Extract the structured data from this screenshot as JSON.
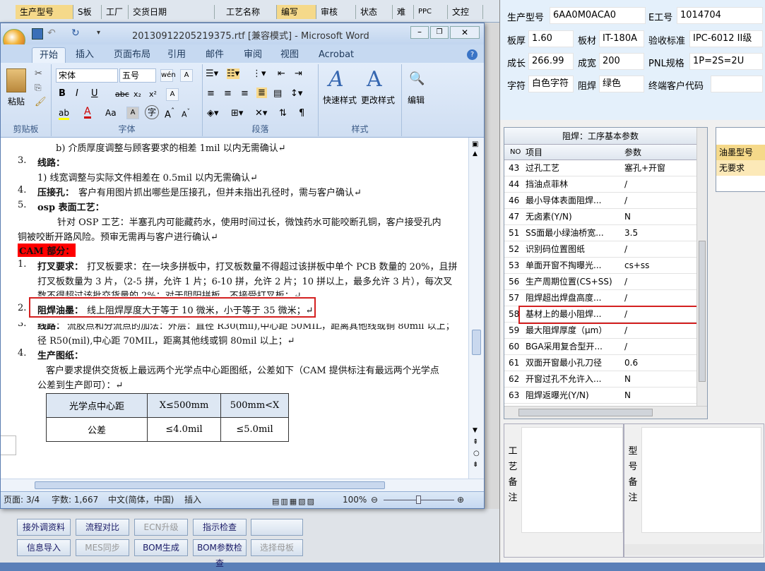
{
  "top_columns": [
    "生产型号",
    "S板",
    "工厂",
    "交货日期",
    "工艺名称",
    "编写",
    "审核",
    "状态",
    "难",
    "PPC",
    "文控"
  ],
  "info": {
    "prod_model_label": "生产型号",
    "prod_model": "6AA0M0ACA0",
    "e_no_label": "E工号",
    "e_no": "1014704",
    "thickness_label": "板厚",
    "thickness": "1.60",
    "material_label": "板材",
    "material": "IT-180A",
    "standard_label": "验收标准",
    "standard": "IPC-6012 II级",
    "length_label": "成长",
    "length": "266.99",
    "width_label": "成宽",
    "width": "200",
    "pnl_label": "PNL规格",
    "pnl": "1P=2S=2U",
    "char_label": "字符",
    "char": "白色字符",
    "mask_label": "阻焊",
    "mask": "绿色",
    "customer_label": "终端客户代码",
    "customer": ""
  },
  "param_grid": {
    "title": "阻焊：工序基本参数",
    "col_no": "NO",
    "col_item": "项目",
    "col_param": "参数",
    "rows": [
      {
        "no": "43",
        "item": "过孔工艺",
        "param": "塞孔+开窗"
      },
      {
        "no": "44",
        "item": "挡油点菲林",
        "param": "/"
      },
      {
        "no": "46",
        "item": "最小导体表面阻焊...",
        "param": "/"
      },
      {
        "no": "47",
        "item": "无卤素(Y/N)",
        "param": "N"
      },
      {
        "no": "51",
        "item": "SS面最小绿油桥宽...",
        "param": "3.5"
      },
      {
        "no": "52",
        "item": "识别码位置图纸",
        "param": "/"
      },
      {
        "no": "53",
        "item": "单面开窗不掏曝光...",
        "param": "cs+ss"
      },
      {
        "no": "56",
        "item": "生产周期位置(CS+SS)",
        "param": "/"
      },
      {
        "no": "57",
        "item": "阻焊超出焊盘高度...",
        "param": "/"
      },
      {
        "no": "58",
        "item": "基材上的最小阻焊...",
        "param": "/"
      },
      {
        "no": "59",
        "item": "最大阻焊厚度（μm）",
        "param": "/"
      },
      {
        "no": "60",
        "item": "BGA采用复合型开...",
        "param": "/"
      },
      {
        "no": "61",
        "item": "双面开窗最小孔刀径",
        "param": "0.6"
      },
      {
        "no": "62",
        "item": "开窗过孔不允许入...",
        "param": "N"
      },
      {
        "no": "63",
        "item": "阻焊返曝光(Y/N)",
        "param": "N"
      }
    ]
  },
  "ink_grid": {
    "header": "油墨型号",
    "value": "无要求"
  },
  "notes": {
    "process_label": "工艺备注",
    "model_label": "型号备注"
  },
  "bottom_buttons": [
    {
      "label": "接外调资料",
      "enabled": true
    },
    {
      "label": "流程对比",
      "enabled": true
    },
    {
      "label": "ECN升级",
      "enabled": false
    },
    {
      "label": "指示检查",
      "enabled": true
    },
    {
      "label": "",
      "enabled": true
    },
    {
      "label": "信息导入",
      "enabled": true
    },
    {
      "label": "MES同步",
      "enabled": false
    },
    {
      "label": "BOM生成",
      "enabled": true
    },
    {
      "label": "BOM参数检查",
      "enabled": true
    },
    {
      "label": "选择母板",
      "enabled": false
    }
  ],
  "word": {
    "title": "20130912205219375.rtf [兼容模式] - Microsoft Word",
    "tabs": [
      "开始",
      "插入",
      "页面布局",
      "引用",
      "邮件",
      "审阅",
      "视图",
      "Acrobat"
    ],
    "font_name": "宋体",
    "font_size": "五号",
    "groups": {
      "clipboard": "剪贴板",
      "font": "字体",
      "paragraph": "段落",
      "styles": "样式",
      "edit": "编辑"
    },
    "paste": "粘贴",
    "quick_styles": "快速样式",
    "change_styles": "更改样式",
    "edit_btn": "编辑",
    "status": {
      "page": "页面: 3/4",
      "words": "字数: 1,667",
      "lang": "中文(简体，中国)",
      "mode": "插入",
      "zoom": "100%"
    },
    "lines": [
      "b)   介质厚度调整与顾客要求的相差 1mil 以内无需确认↵",
      "3.",
      "线路：",
      "1) 线宽调整与实际文件相差在 0.5mil 以内无需确认↵",
      "4.",
      "压接孔：",
      "客户有用图片抓出哪些是压接孔，但并未指出孔径时，需与客户确认↵",
      "5.",
      "osp 表面工艺：",
      "针对 OSP 工艺：半塞孔内可能藏药水，使用时间过长，微蚀药水可能咬断孔铜，客户接受孔内",
      "铜被咬断开路风险。预审无需再与客户进行确认↵",
      "CAM 部分：",
      "1.",
      "打叉要求：",
      "打叉板要求：在一块多拼板中，打叉板数量不得超过该拼板中单个 PCB 数量的 20%，且拼",
      "打叉板数量为 3 片，（2-5 拼，允许 1 片；6-10 拼，允许 2 片；10 拼以上，最多允许 3 片），每次叉",
      "数不得超过该批交货量的 2%；对于阴阳拼板，不接受打叉板；↵",
      "2.",
      "阻焊油墨：",
      "线上阻焊厚度大于等于 10 微米，小于等于 35 微米；↵",
      "3.",
      "线路：",
      "流胶点和分流点的加法：外层：直径 R30(mil),中心距 50MIL，距离其他线或铜 80mil 以上；",
      "径 R50(mil),中心距 70MIL，距离其他线或铜 80mil 以上；↵",
      "4.",
      "生产图纸：",
      "客户要求提供交货板上最远两个光学点中心距图纸，公差如下（CAM 提供标注有最远两个光学点",
      "公差到生产即可）：↵"
    ],
    "table": {
      "h1": "光学点中心距",
      "h2": "X≤500mm",
      "h3": "500mm<X",
      "r1": "公差",
      "r2": "≤4.0mil",
      "r3": "≤5.0mil"
    }
  }
}
